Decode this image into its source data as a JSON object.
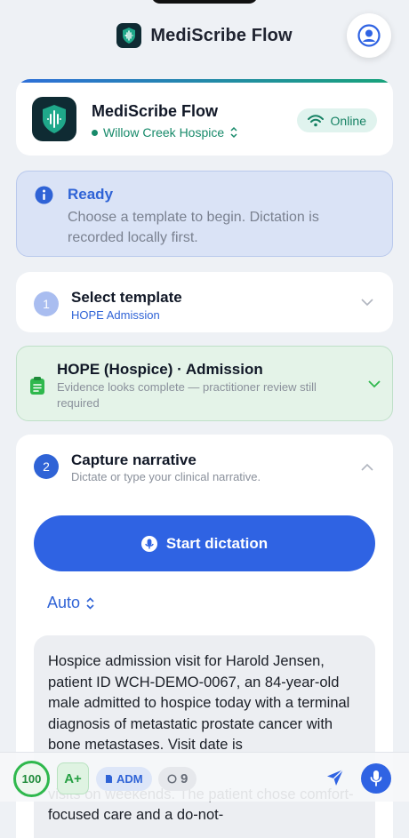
{
  "app": {
    "title": "MediScribe Flow"
  },
  "header_card": {
    "title": "MediScribe Flow",
    "facility": "Willow Creek Hospice",
    "status": "Online"
  },
  "ready_banner": {
    "title": "Ready",
    "message": "Choose a template to begin. Dictation is recorded locally first."
  },
  "step1": {
    "number": "1",
    "title": "Select template",
    "selected": "HOPE Admission"
  },
  "hope_card": {
    "title": "HOPE (Hospice) · Admission",
    "message": "Evidence looks complete — practitioner review still required"
  },
  "step2": {
    "number": "2",
    "title": "Capture narrative",
    "subtitle": "Dictate or type your clinical narrative.",
    "dictation_label": "Start dictation",
    "language_mode": "Auto",
    "narrative_visible": "Hospice admission visit for Harold Jensen, patient ID WCH-DEMO-0067, an 84-year-old male admitted to hospice today with a terminal diagnosis of metastatic prostate cancer with bone metastases. Visit date is",
    "narrative_behind_bar": "visits on weekends. The patient chose comfort-focused care and a do-not-"
  },
  "bottom_bar": {
    "score": "100",
    "grade": "A+",
    "template_code": "ADM",
    "count": "9"
  },
  "colors": {
    "primary_blue": "#2f63e3",
    "brand_dark": "#0f2b33",
    "success_green": "#2fb84d",
    "teal": "#178a6a"
  }
}
